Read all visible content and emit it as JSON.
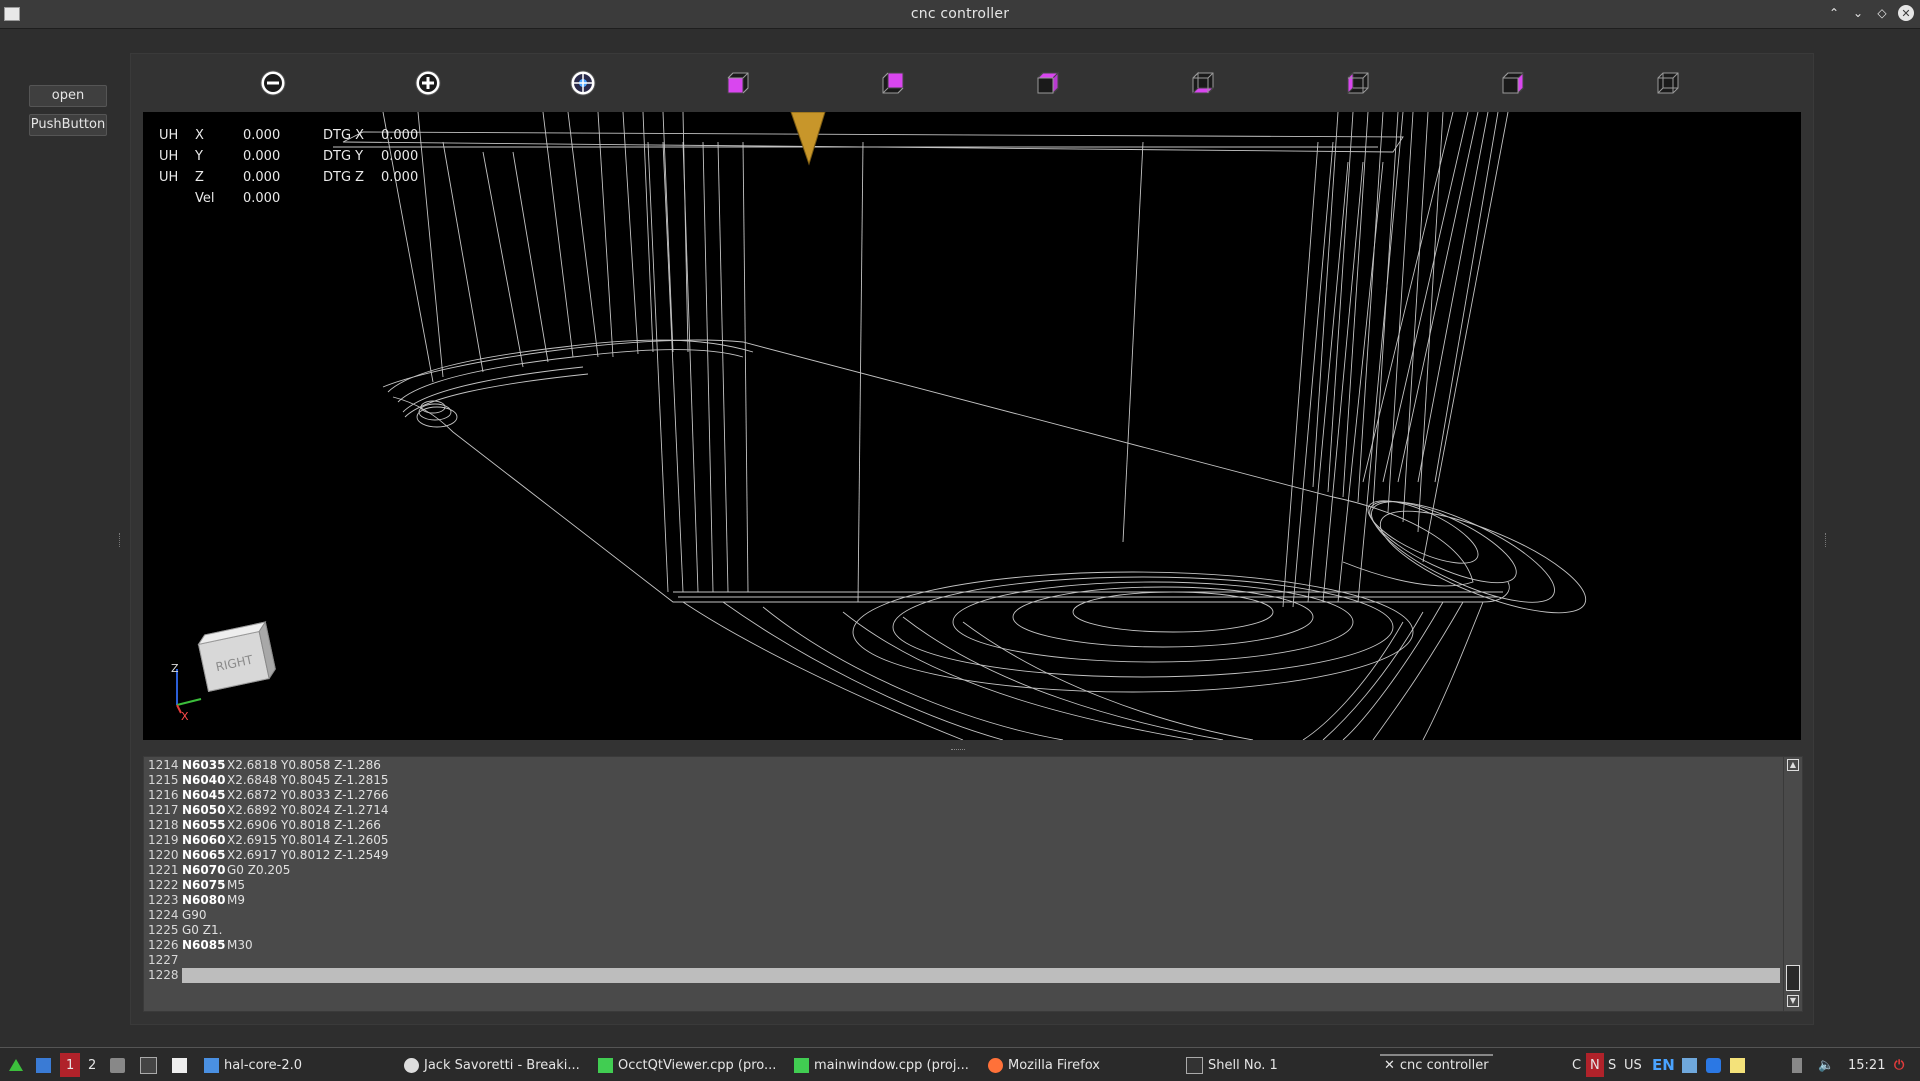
{
  "window": {
    "title": "cnc controller"
  },
  "left_panel": {
    "open_label": "open",
    "pushbutton_label": "PushButton"
  },
  "toolbar": {
    "buttons": [
      "zoom-out",
      "zoom-in",
      "fit-all",
      "view-front",
      "view-top",
      "view-iso",
      "view-bottom",
      "view-left",
      "view-right",
      "view-back"
    ]
  },
  "dro": {
    "rows": [
      {
        "unit": "UH",
        "axis": "X",
        "value": "0.000",
        "dtg_label": "DTG X",
        "dtg_value": "0.000"
      },
      {
        "unit": "UH",
        "axis": "Y",
        "value": "0.000",
        "dtg_label": "DTG Y",
        "dtg_value": "0.000"
      },
      {
        "unit": "UH",
        "axis": "Z",
        "value": "0.000",
        "dtg_label": "DTG Z",
        "dtg_value": "0.000"
      }
    ],
    "vel_label": "Vel",
    "vel_value": "0.000"
  },
  "view_cube": {
    "face_label": "RIGHT",
    "axis_z": "Z",
    "axis_x": "X"
  },
  "gcode": {
    "lines": [
      {
        "num": "1214",
        "n": "N6035",
        "code": "X2.6818 Y0.8058 Z-1.286"
      },
      {
        "num": "1215",
        "n": "N6040",
        "code": "X2.6848 Y0.8045 Z-1.2815"
      },
      {
        "num": "1216",
        "n": "N6045",
        "code": "X2.6872 Y0.8033 Z-1.2766"
      },
      {
        "num": "1217",
        "n": "N6050",
        "code": "X2.6892 Y0.8024 Z-1.2714"
      },
      {
        "num": "1218",
        "n": "N6055",
        "code": "X2.6906 Y0.8018 Z-1.266"
      },
      {
        "num": "1219",
        "n": "N6060",
        "code": "X2.6915 Y0.8014 Z-1.2605"
      },
      {
        "num": "1220",
        "n": "N6065",
        "code": "X2.6917 Y0.8012 Z-1.2549"
      },
      {
        "num": "1221",
        "n": "N6070",
        "code": "G0 Z0.205"
      },
      {
        "num": "1222",
        "n": "N6075",
        "code": "M5"
      },
      {
        "num": "1223",
        "n": "N6080",
        "code": "M9"
      },
      {
        "num": "1224",
        "n": "",
        "code": "G90"
      },
      {
        "num": "1225",
        "n": "",
        "code": "G0 Z1."
      },
      {
        "num": "1226",
        "n": "N6085",
        "code": "M30"
      },
      {
        "num": "1227",
        "n": "",
        "code": ""
      },
      {
        "num": "1228",
        "n": "",
        "code": ""
      }
    ]
  },
  "taskbar": {
    "workspace_1": "1",
    "workspace_2": "2",
    "items": [
      {
        "label": "hal-core-2.0",
        "icon": "folder-icon"
      },
      {
        "label": "Jack Savoretti - Breaki...",
        "icon": "media-icon"
      },
      {
        "label": "OcctQtViewer.cpp (pro...",
        "icon": "qt-icon"
      },
      {
        "label": "mainwindow.cpp (proj...",
        "icon": "qt-icon"
      },
      {
        "label": "Mozilla Firefox",
        "icon": "firefox-icon"
      },
      {
        "label": "Shell No. 1",
        "icon": "terminal-icon"
      },
      {
        "label": "cnc controller",
        "icon": "x-icon"
      }
    ],
    "tray": {
      "c": "C",
      "n": "N",
      "s": "S",
      "layout": "US",
      "lang": "EN",
      "clock": "15:21"
    }
  },
  "colors": {
    "background": "#2e2e2e",
    "viewport": "#000000",
    "toolpath": "#e6e6e6",
    "tool": "#c8962a",
    "cube_face": "#d946ef",
    "editor_bg": "#4a4a4a",
    "current_line": "#bdbdbd"
  }
}
